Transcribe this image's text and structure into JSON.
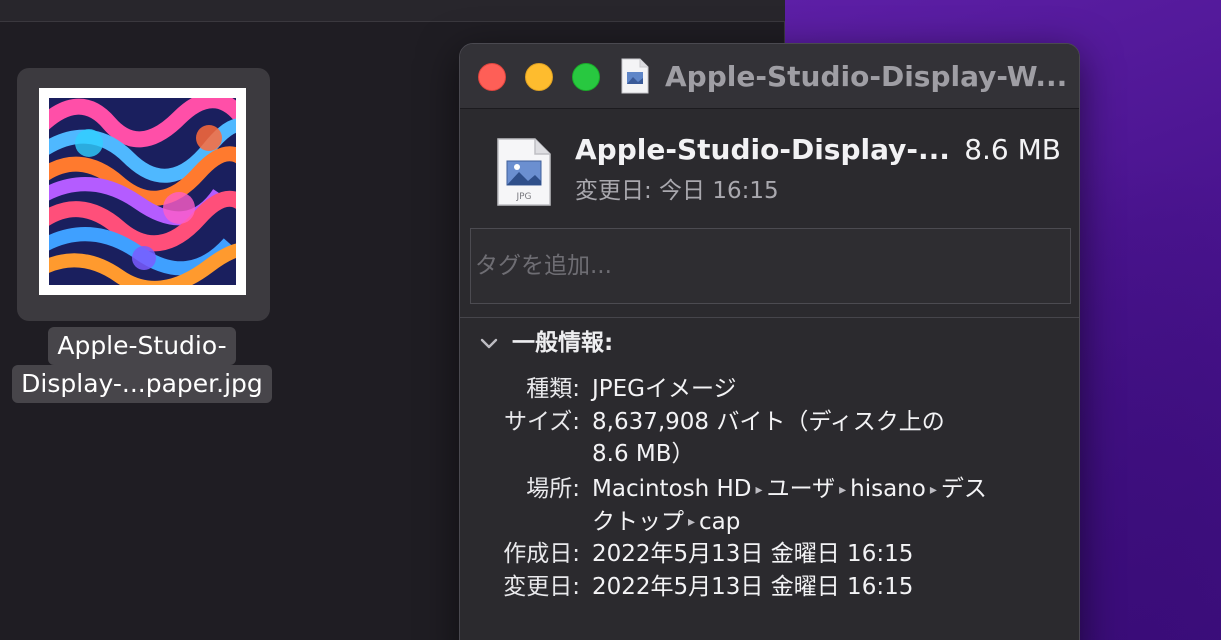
{
  "desktop": {
    "file_label_line1": "Apple-Studio-",
    "file_label_line2": "Display-...paper.jpg"
  },
  "info_window": {
    "title": "Apple-Studio-Display-W...",
    "header": {
      "file_name": "Apple-Studio-Display-...",
      "file_size": "8.6 MB",
      "modified": "変更日: 今日 16:15"
    },
    "tags_placeholder": "タグを追加...",
    "general_section": {
      "title": "一般情報:",
      "kind_label": "種類:",
      "kind_value": "JPEGイメージ",
      "size_label": "サイズ:",
      "size_value_line1": "8,637,908 バイト（ディスク上の",
      "size_value_line2": "8.6 MB）",
      "where_label": "場所:",
      "where_path": [
        "Macintosh HD",
        "ユーザ",
        "hisano",
        "デス"
      ],
      "where_path_line2": [
        "クトップ",
        "cap"
      ],
      "created_label": "作成日:",
      "created_value": "2022年5月13日 金曜日 16:15",
      "modified_label": "変更日:",
      "modified_value": "2022年5月13日 金曜日 16:15"
    },
    "doc_icon_label": "JPG"
  },
  "colors": {
    "close": "#fe5f57",
    "minimize": "#febc2e",
    "maximize": "#28c840",
    "panel_bg": "#2b2a2e",
    "wallpaper": "#4a148f"
  }
}
